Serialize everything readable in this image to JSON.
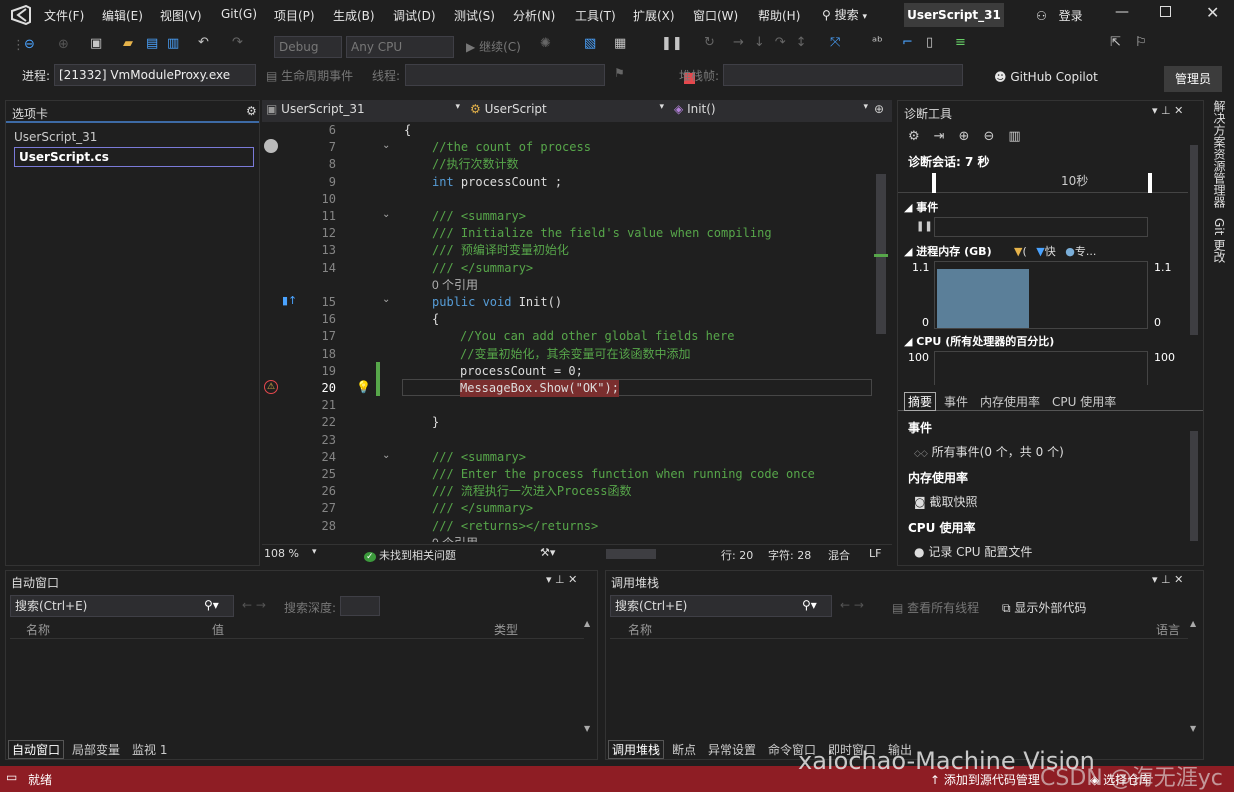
{
  "menu": [
    "文件(F)",
    "编辑(E)",
    "视图(V)",
    "Git(G)",
    "项目(P)",
    "生成(B)",
    "调试(D)",
    "测试(S)",
    "分析(N)",
    "工具(T)",
    "扩展(X)",
    "窗口(W)",
    "帮助(H)"
  ],
  "search_label": "搜索",
  "solution_title": "UserScript_31",
  "login_label": "登录",
  "toolbar": {
    "config": "Debug",
    "platform": "Any CPU",
    "continue_label": "继续(C)",
    "copilot_label": "GitHub Copilot",
    "admin_label": "管理员"
  },
  "process_bar": {
    "process_label": "进程:",
    "process_value": "[21332] VmModuleProxy.exe",
    "lifecycle_label": "生命周期事件",
    "thread_label": "线程:",
    "stack_label": "堆栈帧:"
  },
  "options_panel": {
    "title": "选项卡",
    "items": [
      "UserScript_31",
      "UserScript.cs"
    ]
  },
  "editor": {
    "nav_project": "UserScript_31",
    "nav_class": "UserScript",
    "nav_member": "Init()",
    "lines": [
      {
        "n": "6",
        "t": "{"
      },
      {
        "n": "7",
        "t": "//the count of process"
      },
      {
        "n": "8",
        "t": "//执行次数计数"
      },
      {
        "n": "9",
        "t": "int processCount ;"
      },
      {
        "n": "10",
        "t": ""
      },
      {
        "n": "11",
        "t": "/// <summary>"
      },
      {
        "n": "12",
        "t": "/// Initialize the field's value when compiling"
      },
      {
        "n": "13",
        "t": "/// 预编译时变量初始化"
      },
      {
        "n": "14",
        "t": "/// </summary>"
      },
      {
        "n": "",
        "t": "0 个引用"
      },
      {
        "n": "15",
        "t": "public void Init()"
      },
      {
        "n": "16",
        "t": "{"
      },
      {
        "n": "17",
        "t": "//You can add other global fields here"
      },
      {
        "n": "18",
        "t": "//变量初始化，其余变量可在该函数中添加"
      },
      {
        "n": "19",
        "t": "processCount = 0;"
      },
      {
        "n": "20",
        "t": "MessageBox.Show(\"OK\");"
      },
      {
        "n": "21",
        "t": ""
      },
      {
        "n": "22",
        "t": "}"
      },
      {
        "n": "23",
        "t": ""
      },
      {
        "n": "24",
        "t": "/// <summary>"
      },
      {
        "n": "25",
        "t": "/// Enter the process function when running code once"
      },
      {
        "n": "26",
        "t": "/// 流程执行一次进入Process函数"
      },
      {
        "n": "27",
        "t": "/// </summary>"
      },
      {
        "n": "28",
        "t": "/// <returns></returns>"
      },
      {
        "n": "",
        "t": "0 个引用"
      }
    ],
    "status": {
      "zoom": "108 %",
      "issues": "未找到相关问题",
      "line": "行: 20",
      "col": "字符: 28",
      "mixed": "混合",
      "eol": "LF"
    }
  },
  "diagnostics": {
    "title": "诊断工具",
    "session": "诊断会话: 7 秒",
    "timeline_label": "10秒",
    "events_label": "事件",
    "memory_label": "进程内存 (GB)",
    "memory_legend": [
      "(",
      "快",
      "专..."
    ],
    "mem_max": "1.1",
    "mem_min": "0",
    "memory_fill": 0.9,
    "cpu_label": "CPU (所有处理器的百分比)",
    "cpu_max": "100",
    "tabs": [
      "摘要",
      "事件",
      "内存使用率",
      "CPU 使用率"
    ],
    "sections": [
      {
        "title": "事件",
        "item": "所有事件(0 个，共 0 个)"
      },
      {
        "title": "内存使用率",
        "item": "截取快照"
      },
      {
        "title": "CPU 使用率",
        "item": "记录 CPU 配置文件"
      }
    ]
  },
  "side_tabs": [
    "解决方案资源管理器",
    "Git 更改"
  ],
  "autos": {
    "title": "自动窗口",
    "search_placeholder": "搜索(Ctrl+E)",
    "depth_label": "搜索深度:",
    "columns": [
      "名称",
      "值",
      "类型"
    ],
    "tabs": [
      "自动窗口",
      "局部变量",
      "监视 1"
    ]
  },
  "callstack": {
    "title": "调用堆栈",
    "search_placeholder": "搜索(Ctrl+E)",
    "all_threads": "查看所有线程",
    "external_code": "显示外部代码",
    "columns": [
      "名称",
      "语言"
    ],
    "tabs": [
      "调用堆栈",
      "断点",
      "异常设置",
      "命令窗口",
      "即时窗口",
      "输出"
    ]
  },
  "statusbar": {
    "ready": "就绪",
    "source_control": "添加到源代码管理",
    "repo": "选择仓库",
    "watermark": "xaiochao-Machine Vision",
    "watermark2": "CSDN @海无涯yc"
  },
  "colors": {
    "accent": "#68217a",
    "status_bar": "#8e1d24",
    "comment": "#57a64a",
    "keyword": "#569cd6"
  }
}
